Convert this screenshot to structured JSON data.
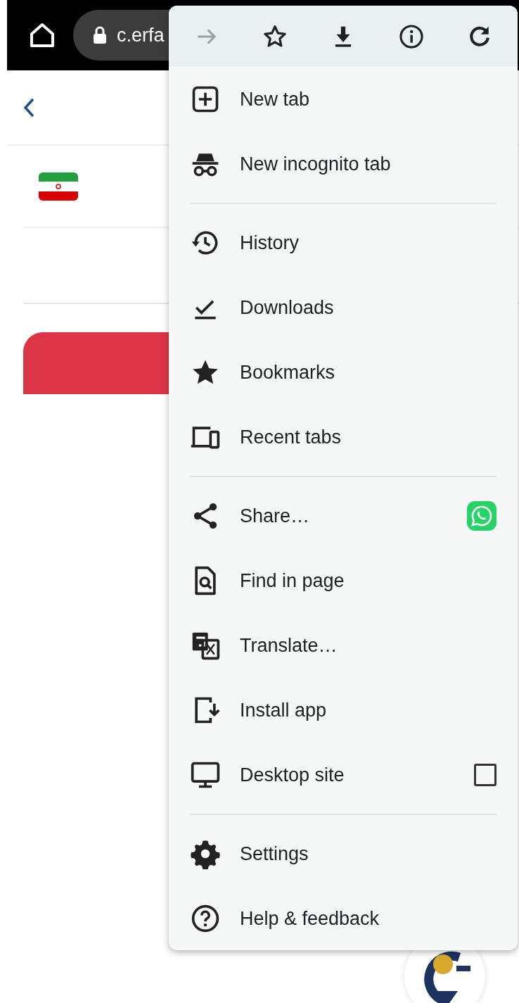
{
  "address_bar": {
    "url": "c.erfa"
  },
  "menu": {
    "toolbar": [
      {
        "disabled": true
      },
      {
        "disabled": false
      },
      {
        "disabled": false
      },
      {
        "disabled": false
      },
      {
        "disabled": false
      }
    ],
    "groups": [
      {
        "items": [
          {
            "kind": "plain",
            "label": "New tab"
          },
          {
            "kind": "plain",
            "label": "New incognito tab"
          }
        ]
      },
      {
        "items": [
          {
            "kind": "plain",
            "label": "History"
          },
          {
            "kind": "plain",
            "label": "Downloads"
          },
          {
            "kind": "plain",
            "label": "Bookmarks"
          },
          {
            "kind": "plain",
            "label": "Recent tabs"
          }
        ]
      },
      {
        "items": [
          {
            "kind": "share",
            "label": "Share…"
          },
          {
            "kind": "plain",
            "label": "Find in page"
          },
          {
            "kind": "plain",
            "label": "Translate…"
          },
          {
            "kind": "plain",
            "label": "Install app"
          },
          {
            "kind": "checkbox",
            "label": "Desktop site",
            "checked": false
          }
        ]
      },
      {
        "items": [
          {
            "kind": "plain",
            "label": "Settings"
          },
          {
            "kind": "plain",
            "label": "Help & feedback"
          }
        ]
      }
    ]
  }
}
